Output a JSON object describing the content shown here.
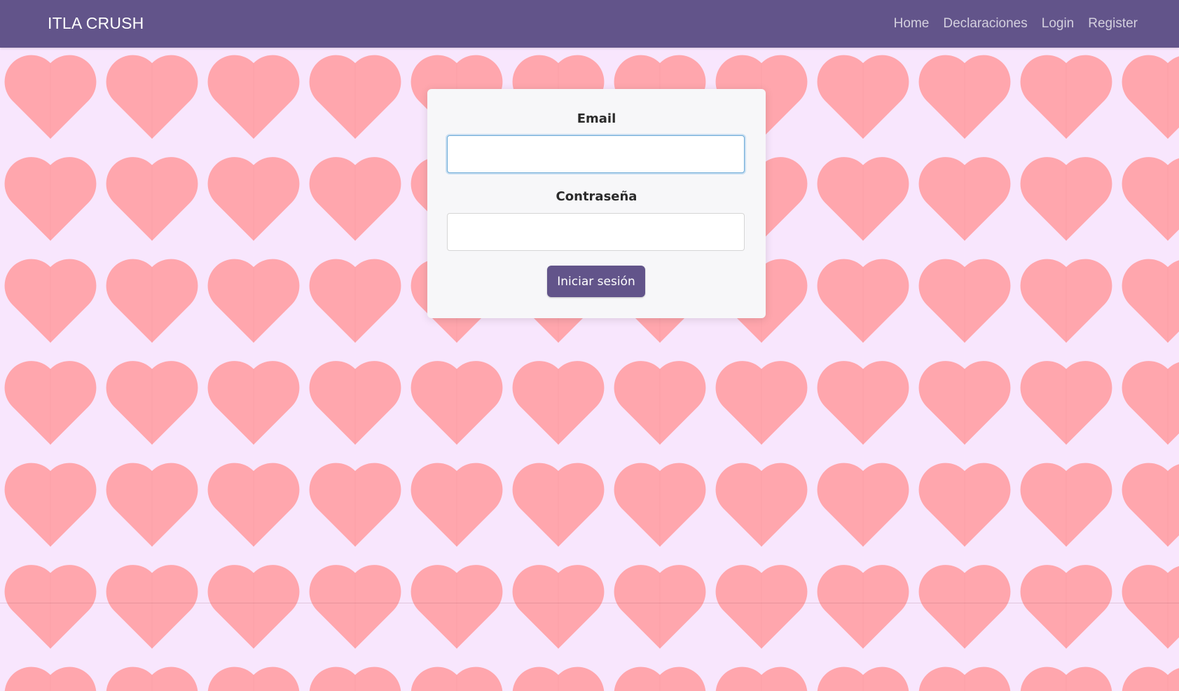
{
  "navbar": {
    "brand": "ITLA CRUSH",
    "links": [
      "Home",
      "Declaraciones",
      "Login",
      "Register"
    ]
  },
  "login_form": {
    "email_label": "Email",
    "email_value": "",
    "password_label": "Contraseña",
    "password_value": "",
    "submit_label": "Iniciar sesión"
  },
  "colors": {
    "navbar_bg": "#62548a",
    "page_bg": "#f8e6fd",
    "heart": "#ffa6ad",
    "button_bg": "#62548a"
  },
  "background": {
    "pattern": "heart-icon"
  }
}
